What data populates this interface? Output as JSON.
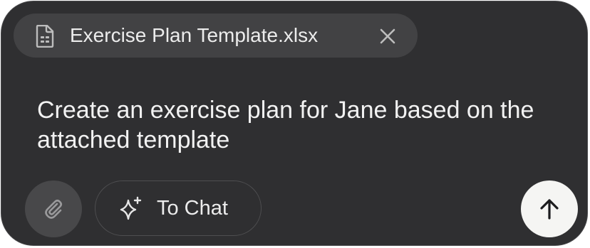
{
  "attachment": {
    "file_name": "Exercise Plan Template.xlsx",
    "icon": "spreadsheet-file-icon",
    "remove_icon": "close-icon"
  },
  "prompt": {
    "text": "Create an exercise plan for Jane based on the attached template"
  },
  "toolbar": {
    "attach_icon": "paperclip-icon",
    "to_chat_label": "To Chat",
    "to_chat_icon": "sparkle-icon",
    "send_icon": "arrow-up-icon"
  },
  "colors": {
    "background": "#2f2f31",
    "chip": "#424244",
    "text": "#f2f2f2",
    "send_button": "#f5f5f3"
  }
}
